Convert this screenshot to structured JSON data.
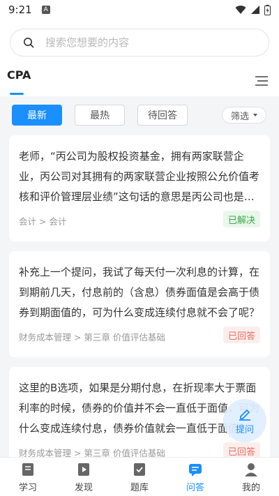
{
  "status": {
    "time": "9:21",
    "notif": "A"
  },
  "search": {
    "placeholder": "搜索您想要的内容"
  },
  "tabs": {
    "current": "CPA"
  },
  "filters": {
    "latest": "最新",
    "hottest": "最热",
    "pending": "待回答",
    "filter": "筛选"
  },
  "questions": [
    {
      "text": "老师，“丙公司为股权投资基金，拥有两家联营企业，丙公司对其拥有的两家联营企业按照公允价值考核和评价管理层业绩”这句话的意思是丙公司也是投资性主体吗？",
      "category": "会计 > 会计",
      "status": "已解决"
    },
    {
      "text": "补充上一个提问，我试了每天付一次利息的计算，在到期前几天，付息前的（含息）债券面值是会高于债券到期面值的，可为什么变成连续付息就不会了呢？",
      "category": "财务成本管理 > 第三章 价值评估基础",
      "status": "已回答"
    },
    {
      "text": "这里的B选项，如果是分期付息，在折现率大于票面利率的时候，债券的价值并不会一直低于面值，可为什么变成连续付息，债券价值就会一直低于面值？",
      "category": "财务成本管理 > 第三章 价值评估基础",
      "status": "已回答"
    }
  ],
  "fab": {
    "label": "提问"
  },
  "nav": {
    "study": "学习",
    "discover": "发现",
    "bank": "题库",
    "qa": "问答",
    "mine": "我的"
  },
  "colors": {
    "accent": "#1a8fff",
    "solved": "#3aaa48",
    "answered": "#e86f5c"
  }
}
